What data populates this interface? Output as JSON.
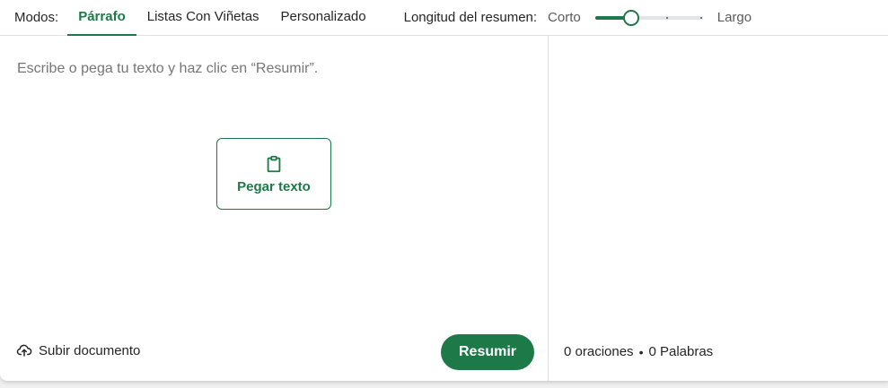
{
  "toolbar": {
    "modes_label": "Modos:",
    "tabs": [
      {
        "label": "Párrafo",
        "active": true
      },
      {
        "label": "Listas Con Viñetas",
        "active": false
      },
      {
        "label": "Personalizado",
        "active": false
      }
    ],
    "length_label": "Longitud del resumen:",
    "short_label": "Corto",
    "long_label": "Largo",
    "slider_value": 0.33
  },
  "editor": {
    "placeholder": "Escribe o pega tu texto y haz clic en “Resumir”.",
    "paste_label": "Pegar texto",
    "upload_label": "Subir documento",
    "summarize_label": "Resumir"
  },
  "output": {
    "sentences": "0 oraciones",
    "separator": "•",
    "words": "0 Palabras"
  },
  "colors": {
    "accent": "#1d7a48"
  },
  "icons": {
    "paste": "clipboard-icon",
    "upload": "cloud-upload-icon"
  }
}
